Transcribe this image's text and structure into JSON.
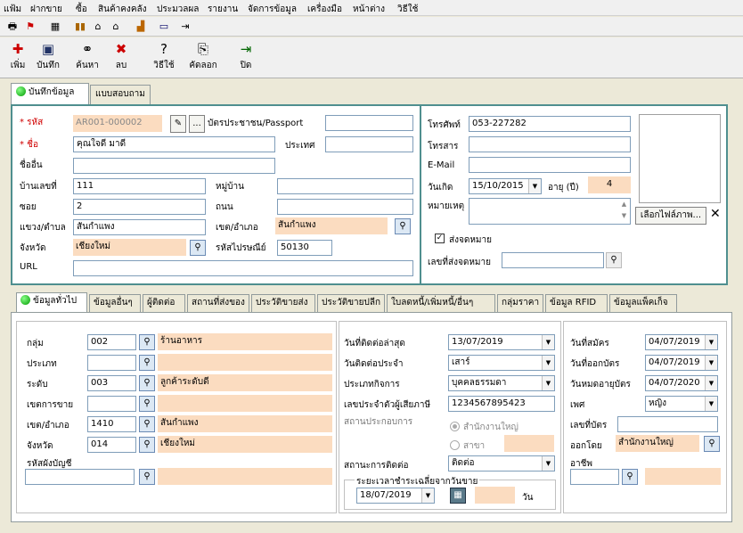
{
  "menu": [
    "แฟ้ม",
    "ฝากขาย",
    "ซื้อ",
    "สินค้าคงคลัง",
    "ประมวลผล",
    "รายงาน",
    "จัดการข้อมูล",
    "เครื่องมือ",
    "หน้าต่าง",
    "วิธีใช้"
  ],
  "toolbar": {
    "add": "เพิ่ม",
    "save": "บันทึก",
    "find": "ค้นหา",
    "delete": "ลบ",
    "help": "วิธีใช้",
    "copy": "คัดลอก",
    "close": "ปิด"
  },
  "tabs": {
    "record": "บันทึกข้อมูล",
    "survey": "แบบสอบถาม"
  },
  "form": {
    "code_label": "* รหัส",
    "code_value": "AR001-000002",
    "code_btn": "...",
    "idcard_label": "บัตรประชาชน/Passport",
    "idcard_value": "",
    "name_label": "* ชื่อ",
    "name_value": "คุณใจดี มาดี",
    "country_label": "ประเทศ",
    "country_value": "",
    "othername_label": "ชื่ออื่น",
    "othername_value": "",
    "houseno_label": "บ้านเลขที่",
    "houseno_value": "111",
    "village_label": "หมู่บ้าน",
    "village_value": "",
    "soi_label": "ซอย",
    "soi_value": "2",
    "road_label": "ถนน",
    "road_value": "",
    "subdistrict_label": "แขวง/ตำบล",
    "subdistrict_value": "สันกำแพง",
    "district_label": "เขต/อำเภอ",
    "district_value": "สันกำแพง",
    "province_label": "จังหวัด",
    "province_value": "เชียงใหม่",
    "zip_label": "รหัสไปรษณีย์",
    "zip_value": "50130",
    "url_label": "URL",
    "url_value": "",
    "phone_label": "โทรศัพท์",
    "phone_value": "053-227282",
    "fax_label": "โทรสาร",
    "fax_value": "",
    "email_label": "E-Mail",
    "email_value": "",
    "birth_label": "วันเกิด",
    "birth_value": "15/10/2015",
    "age_label": "อายุ (ปี)",
    "age_value": "4",
    "note_label": "หมายเหตุ",
    "note_value": "",
    "file_btn": "เลือกไฟล์ภาพ...",
    "mail_check_label": "ส่งจดหมาย",
    "mail_no_label": "เลขที่ส่งจดหมาย",
    "mail_no_value": ""
  },
  "bottom_tabs": [
    "ข้อมูลทั่วไป",
    "ข้อมูลอื่นๆ",
    "ผู้ติดต่อ",
    "สถานที่ส่งของ",
    "ประวัติขายส่ง",
    "ประวัติขายปลีก",
    "ใบลดหนี้/เพิ่มหนี้/อื่นๆ",
    "กลุ่มราคา",
    "ข้อมูล RFID",
    "ข้อมูลแพ็คเก็จ"
  ],
  "general": {
    "group_label": "กลุ่ม",
    "group_code": "002",
    "group_name": "ร้านอาหาร",
    "type_label": "ประเภท",
    "type_code": "",
    "type_name": "",
    "level_label": "ระดับ",
    "level_code": "003",
    "level_name": "ลูกค้าระดับดี",
    "area_label": "เขตการขาย",
    "area_code": "",
    "area_name": "",
    "district_label": "เขต/อำเภอ",
    "district_code": "1410",
    "district_name": "สันกำแพง",
    "province_label": "จังหวัด",
    "province_code": "014",
    "province_name": "เชียงใหม่",
    "account_label": "รหัสผังบัญชี",
    "account_code": "",
    "account_name": "",
    "lastcontact_label": "วันที่ติดต่อล่าสุด",
    "lastcontact_value": "13/07/2019",
    "regularday_label": "วันติดต่อประจำ",
    "regularday_value": "เสาร์",
    "biztype_label": "ประเภทกิจการ",
    "biztype_value": "บุคคลธรรมดา",
    "taxid_label": "เลขประจำตัวผู้เสียภาษี",
    "taxid_value": "1234567895423",
    "bizplace_label": "สถานประกอบการ",
    "hq_label": "สำนักงานใหญ่",
    "branch_label": "สาขา",
    "branch_value": "",
    "contactstatus_label": "สถานะการติดต่อ",
    "contactstatus_value": "ติดต่อ",
    "payavg_label": "ระยะเวลาชำระเฉลี่ยจากวันขาย",
    "payavg_date": "18/07/2019",
    "payavg_days": "",
    "payavg_unit": "วัน",
    "applydate_label": "วันที่สมัคร",
    "applydate_value": "04/07/2019",
    "issuedate_label": "วันที่ออกบัตร",
    "issuedate_value": "04/07/2019",
    "expiredate_label": "วันหมดอายุบัตร",
    "expiredate_value": "04/07/2020",
    "gender_label": "เพศ",
    "gender_value": "หญิง",
    "cardno_label": "เลขที่บัตร",
    "cardno_value": "",
    "issuedby_label": "ออกโดย",
    "issuedby_value": "สำนักงานใหญ่",
    "career_label": "อาชีพ",
    "career_code": "",
    "career_name": ""
  }
}
